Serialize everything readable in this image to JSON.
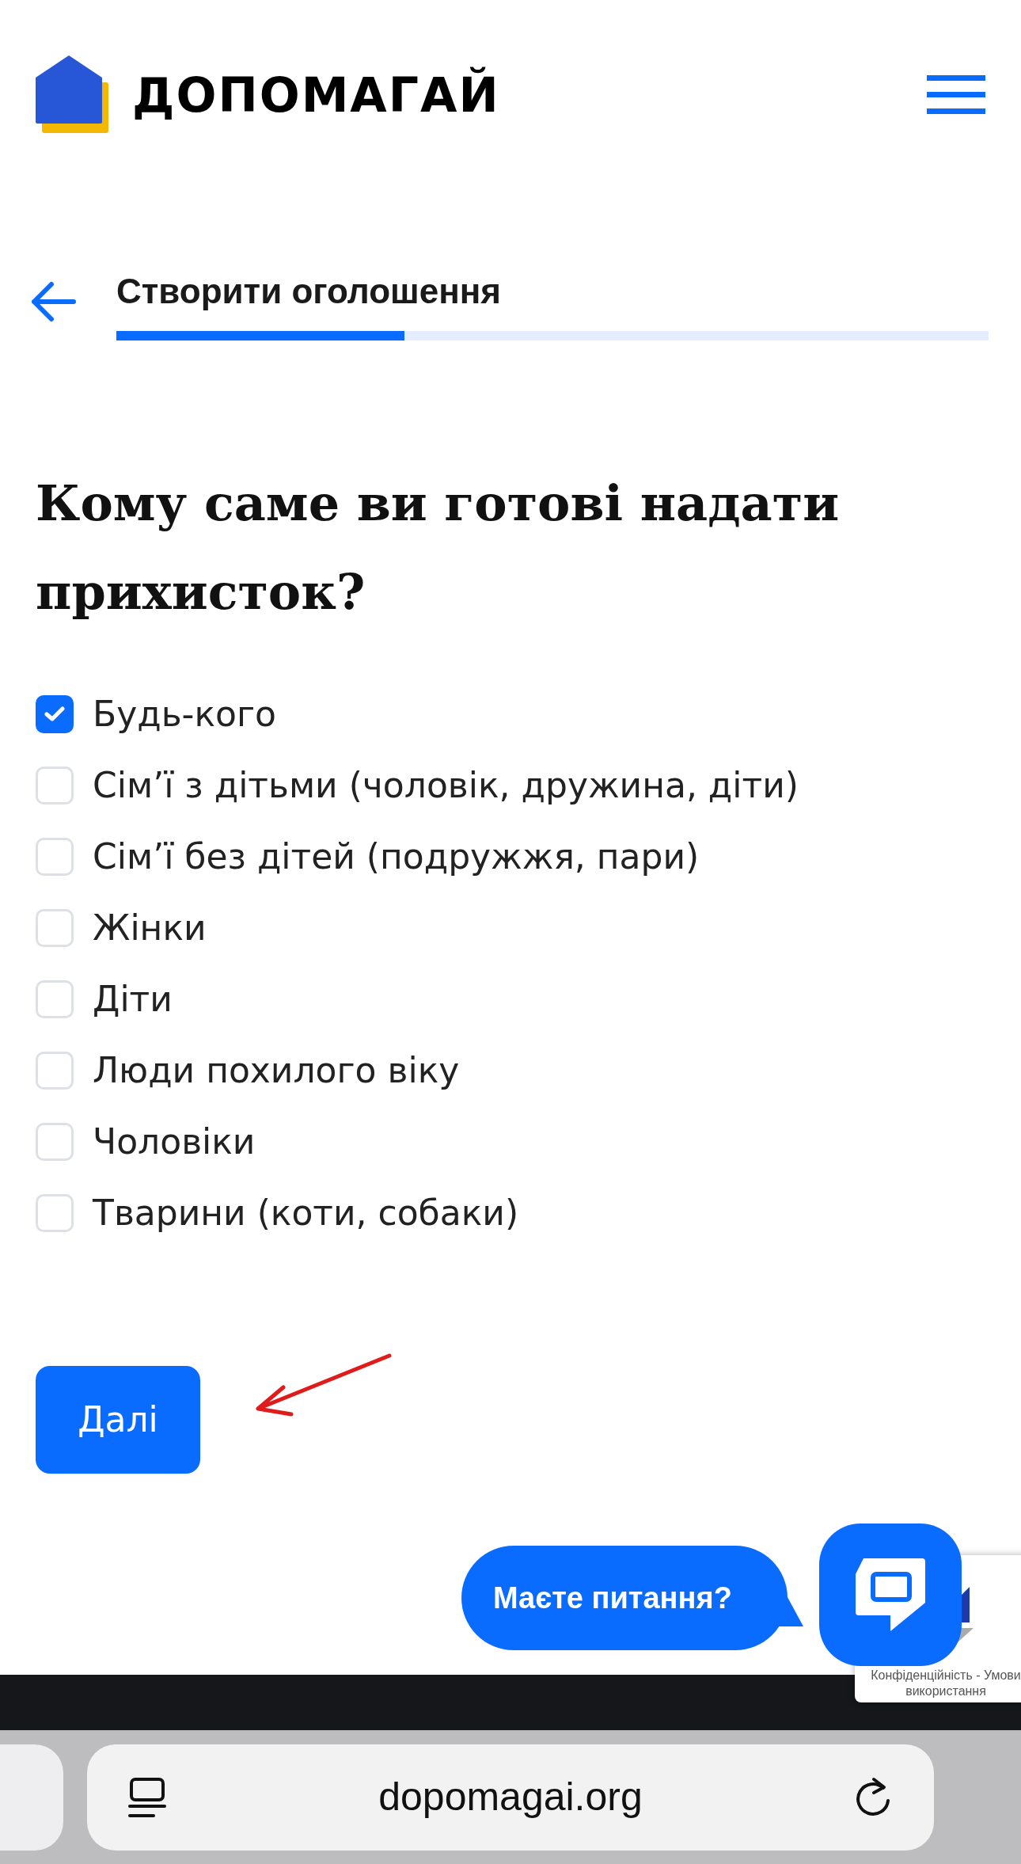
{
  "header": {
    "logo_text": "ДОПОМАГАЙ"
  },
  "step": {
    "title": "Створити оголошення",
    "level": 0.33
  },
  "question": "Кому саме ви готові надати прихисток?",
  "options": [
    {
      "label": "Будь-кого",
      "checked": true
    },
    {
      "label": "Сім’ї з дітьми (чоловік, дружина, діти)",
      "checked": false
    },
    {
      "label": "Сім’ї без дітей (подружжя, пари)",
      "checked": false
    },
    {
      "label": "Жінки",
      "checked": false
    },
    {
      "label": "Діти",
      "checked": false
    },
    {
      "label": "Люди похилого віку",
      "checked": false
    },
    {
      "label": "Чоловіки",
      "checked": false
    },
    {
      "label": "Тварини (коти, собаки)",
      "checked": false
    }
  ],
  "next_button": "Далі",
  "chat": {
    "bubble": "Маєте питання?"
  },
  "recaptcha": {
    "links": "Конфіденційність - Умови використання"
  },
  "browser": {
    "url": "dopomagai.org"
  }
}
